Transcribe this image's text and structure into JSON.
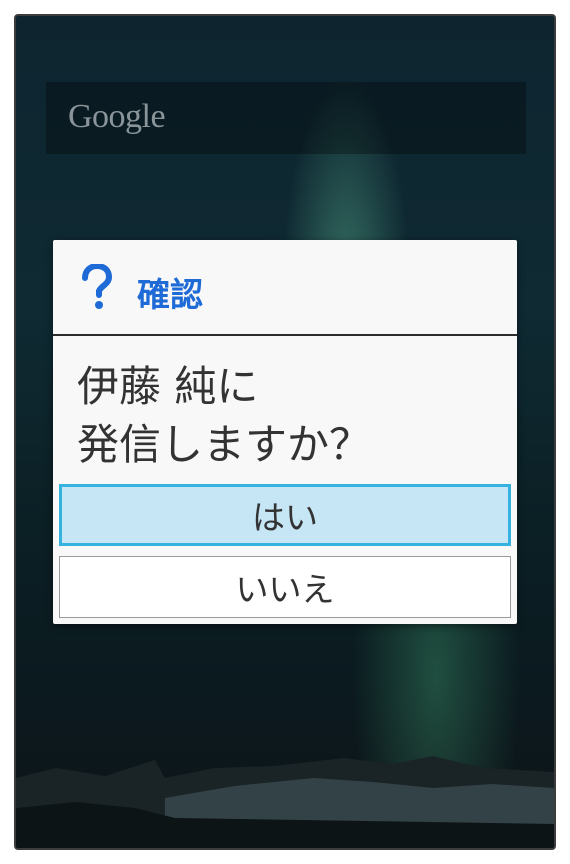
{
  "home_screen": {
    "search_widget": {
      "logo_text": "Google"
    }
  },
  "dialog": {
    "icon": "question-mark-icon",
    "title": "確認",
    "message_line1": "伊藤 純に",
    "message_line2": "発信しますか？",
    "buttons": {
      "yes_label": "はい",
      "no_label": "いいえ"
    }
  },
  "colors": {
    "title_blue": "#1e6ad6",
    "yes_button_bg": "#c6e6f5",
    "yes_button_border": "#35b2de",
    "dialog_bg": "#f8f8f8"
  }
}
